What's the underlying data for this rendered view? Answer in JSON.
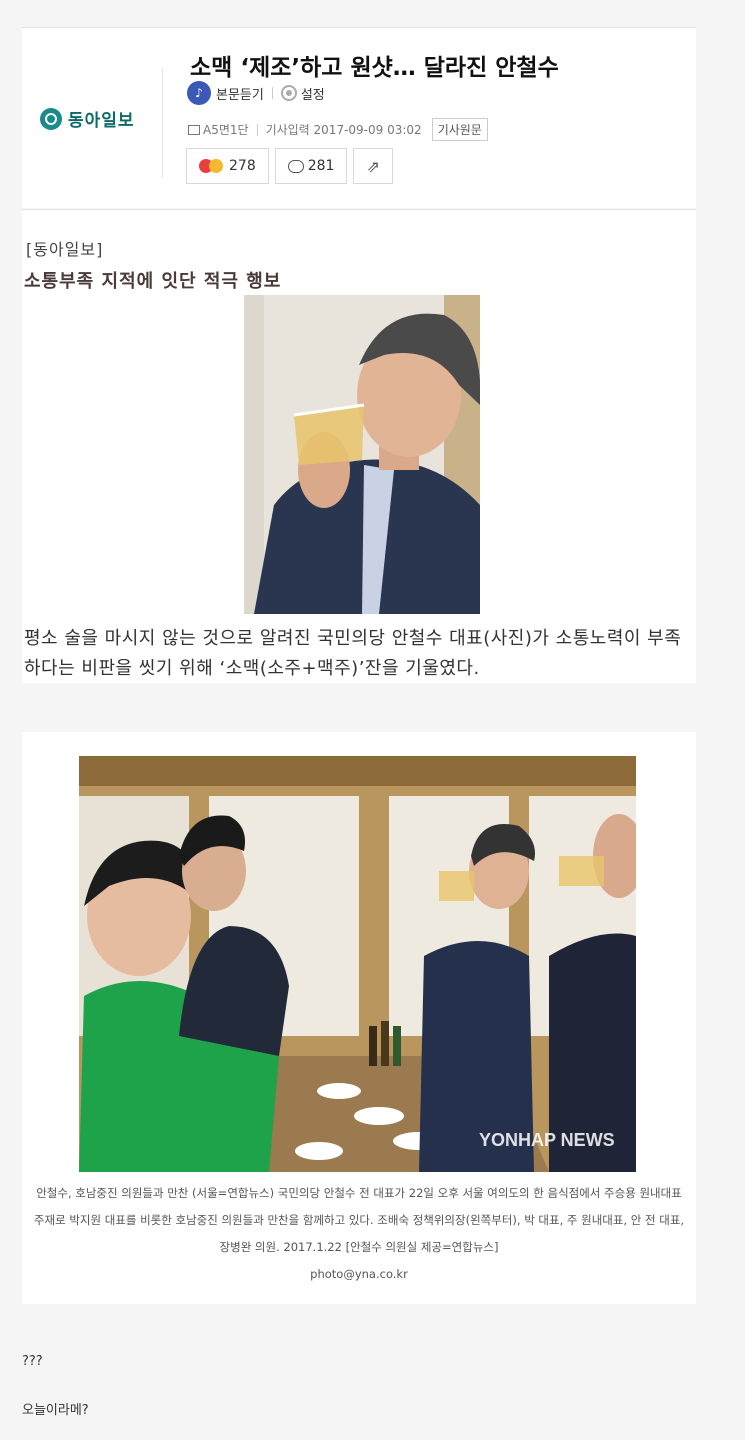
{
  "header": {
    "logo_text": "동아일보",
    "title": "소맥 ‘제조’하고 원샷… 달라진 안철수",
    "listen_label": "본문듣기",
    "settings_label": "설정",
    "page_ref": "A5면1단",
    "date_label": "기사입력 2017-09-09 03:02",
    "original_label": "기사원문",
    "reaction_count": "278",
    "comment_count": "281",
    "icons": {
      "listen": "speaker-icon",
      "settings": "gear-icon",
      "comment": "comment-bubble-icon",
      "share": "share-icon"
    }
  },
  "article": {
    "source": "[동아일보]",
    "subtitle": "소통부족 지적에 잇단 적극 행보",
    "paragraph": "평소 술을 마시지 않는 것으로 알려진 국민의당 안철수 대표(사진)가 소통노력이 부족하다는 비판을 씻기 위해 ‘소맥(소주+맥주)’잔을 기울였다.",
    "photo2_watermark": "YONHAP NEWS",
    "caption": "안철수, 호남중진 의원들과 만찬 (서울=연합뉴스) 국민의당 안철수 전 대표가 22일 오후 서울 여의도의 한 음식점에서 주승용 원내대표 주재로 박지원 대표를 비롯한 호남중진 의원들과 만찬을 함께하고 있다. 조배숙 정책위의장(왼쪽부터), 박 대표, 주 원내대표, 안 전 대표, 장병완 의원. 2017.1.22 [안철수 의원실 제공=연합뉴스]",
    "caption_email": "photo@yna.co.kr"
  },
  "comments": {
    "line1": "???",
    "line2": "오늘이라메?"
  },
  "colors": {
    "brand": "#0e6a6a",
    "listen_icon": "#3b5ab5"
  }
}
